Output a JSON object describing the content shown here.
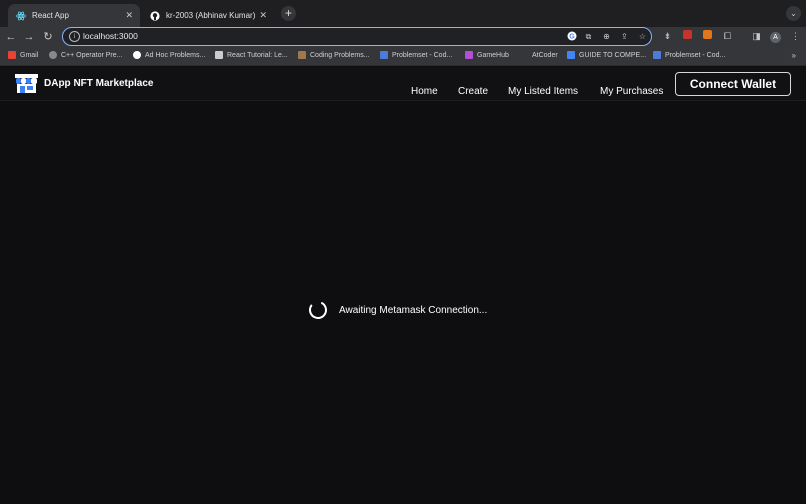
{
  "browser": {
    "tabs": [
      {
        "title": "React App",
        "icon": "react-icon",
        "active": true
      },
      {
        "title": "kr-2003 (Abhinav Kumar)",
        "icon": "github-icon",
        "active": false
      }
    ],
    "new_tab": "+",
    "tab_menu": "⌄",
    "url": "localhost:3000",
    "bookmarks": [
      {
        "label": "Gmail",
        "icon": "gmail-icon",
        "color": "#ea4335"
      },
      {
        "label": "C++ Operator Pre...",
        "icon": "globe-icon",
        "color": "#888888"
      },
      {
        "label": "Ad Hoc Problems...",
        "icon": "atlassian-icon",
        "color": "#ffffff"
      },
      {
        "label": "React Tutorial: Le...",
        "icon": "chart-icon",
        "color": "#cccccc"
      },
      {
        "label": "Coding Problems...",
        "icon": "cc-icon",
        "color": "#a0784c"
      },
      {
        "label": "Problemset - Cod...",
        "icon": "bars-icon",
        "color": "#4c7cd8"
      },
      {
        "label": "GameHub",
        "icon": "gamehub-icon",
        "color": "#b24fd8"
      },
      {
        "label": "AtCoder",
        "icon": "atcoder-icon",
        "color": "#35363a"
      },
      {
        "label": "GUIDE TO COMPE...",
        "icon": "docs-icon",
        "color": "#4285f4"
      },
      {
        "label": "Problemset - Cod...",
        "icon": "bars-icon",
        "color": "#4c7cd8"
      }
    ],
    "bookmarks_more": "»"
  },
  "app": {
    "brand": "DApp NFT Marketplace",
    "nav": [
      "Home",
      "Create",
      "My Listed Items",
      "My Purchases"
    ],
    "connect_label": "Connect Wallet",
    "loading_text": "Awaiting Metamask Connection..."
  },
  "colors": {
    "accent": "#8ab4f8",
    "background": "#0e0e10"
  }
}
